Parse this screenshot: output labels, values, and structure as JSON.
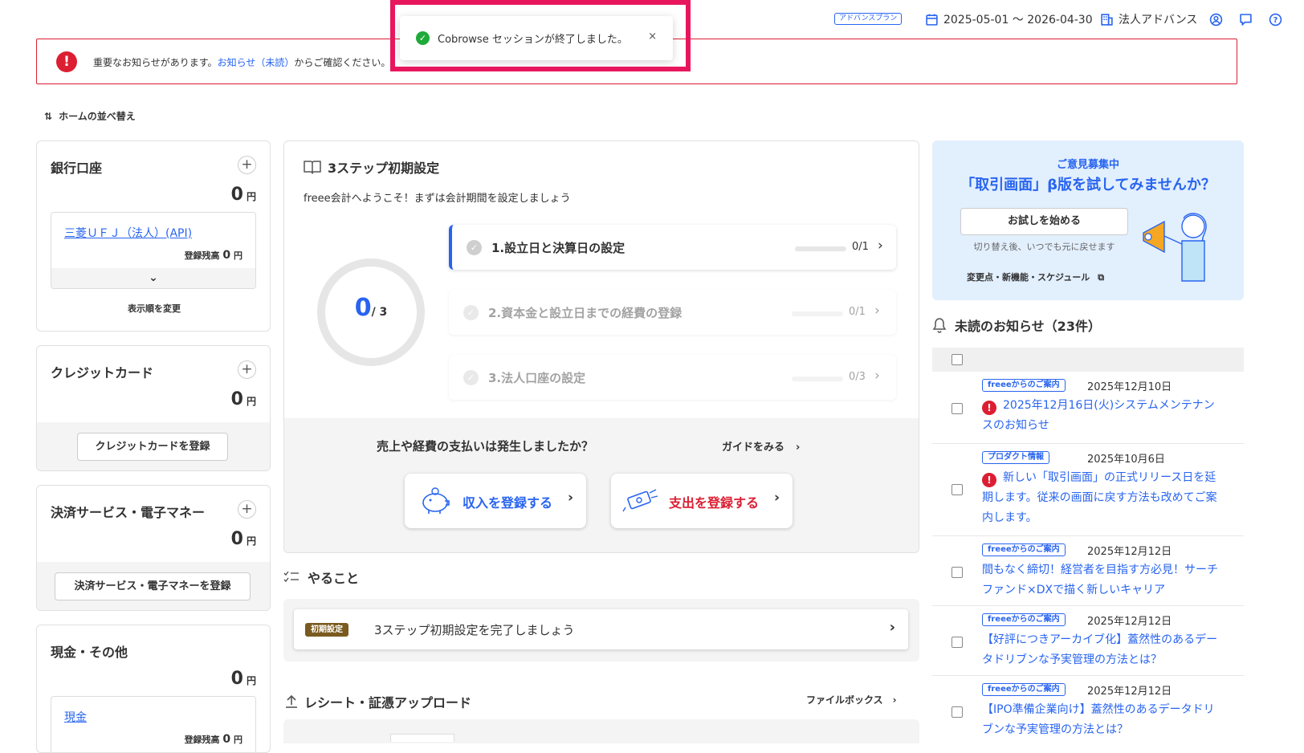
{
  "topbar": {
    "plan": "アドバンスプラン",
    "period": "2025-05-01 〜 2026-04-30",
    "company": "法人アドバンス"
  },
  "toast": {
    "message": "Cobrowse セッションが終了しました。",
    "close": "×"
  },
  "alert": {
    "prefix": "重要なお知らせがあります。",
    "link": "お知らせ（未読）",
    "suffix": "からご確認ください。"
  },
  "sort_label": "ホームの並べ替え",
  "left": {
    "bank": {
      "title": "銀行口座",
      "amount": "0",
      "unit": "円",
      "account_name": "三菱ＵＦＪ（法人）(API)",
      "balance_label": "登録残高",
      "balance": "0",
      "reorder": "表示順を変更"
    },
    "credit": {
      "title": "クレジットカード",
      "amount": "0",
      "unit": "円",
      "button": "クレジットカードを登録"
    },
    "payment": {
      "title": "決済サービス・電子マネー",
      "amount": "0",
      "unit": "円",
      "button": "決済サービス・電子マネーを登録"
    },
    "cash": {
      "title": "現金・その他",
      "amount": "0",
      "unit": "円",
      "account_name": "現金",
      "balance_label": "登録残高",
      "balance": "0"
    }
  },
  "setup": {
    "title": "3ステップ初期設定",
    "welcome": "freee会計へようこそ！まずは会計期間を設定しましょう",
    "progress_value": "0",
    "progress_total": "/ 3",
    "steps": [
      {
        "label": "1.設立日と決算日の設定",
        "count": "0/1"
      },
      {
        "label": "2.資本金と設立日までの経費の登録",
        "count": "0/1"
      },
      {
        "label": "3.法人口座の設定",
        "count": "0/3"
      }
    ],
    "question": "売上や経費の支払いは発生しましたか？",
    "guide": "ガイドをみる",
    "income_button": "収入を登録する",
    "expense_button": "支出を登録する"
  },
  "todo": {
    "title": "やること",
    "tag": "初期設定",
    "text": "3ステップ初期設定を完了しましょう"
  },
  "upload": {
    "title": "レシート・証憑アップロード",
    "filebox": "ファイルボックス"
  },
  "promo": {
    "kicker": "ご意見募集中",
    "headline": "「取引画面」β版を試してみませんか？",
    "button": "お試しを始める",
    "note": "切り替え後、いつでも元に戻せます",
    "link": "変更点・新機能・スケジュール"
  },
  "notices": {
    "title": "未読のお知らせ（23件）",
    "items": [
      {
        "tag": "freeeからのご案内",
        "date": "2025年12月10日",
        "title": "2025年12月16日(火)システムメンテナンスのお知らせ",
        "important": true
      },
      {
        "tag": "プロダクト情報",
        "date": "2025年10月6日",
        "title": "新しい「取引画面」の正式リリース日を延期します。従来の画面に戻す方法も改めてご案内します。",
        "important": true
      },
      {
        "tag": "freeeからのご案内",
        "date": "2025年12月12日",
        "title": "間もなく締切！経営者を目指す方必見！サーチファンド×DXで描く新しいキャリア",
        "important": false
      },
      {
        "tag": "freeeからのご案内",
        "date": "2025年12月12日",
        "title": "【好評につきアーカイブ化】蓋然性のあるデータドリブンな予実管理の方法とは？",
        "important": false
      },
      {
        "tag": "freeeからのご案内",
        "date": "2025年12月12日",
        "title": "【IPO準備企業向け】蓋然性のあるデータドリブンな予実管理の方法とは？",
        "important": false
      }
    ]
  },
  "colors": {
    "accent": "#2864f0",
    "alert": "#dc1e32",
    "highlight_frame": "#e8175d",
    "success": "#1eaa39"
  }
}
